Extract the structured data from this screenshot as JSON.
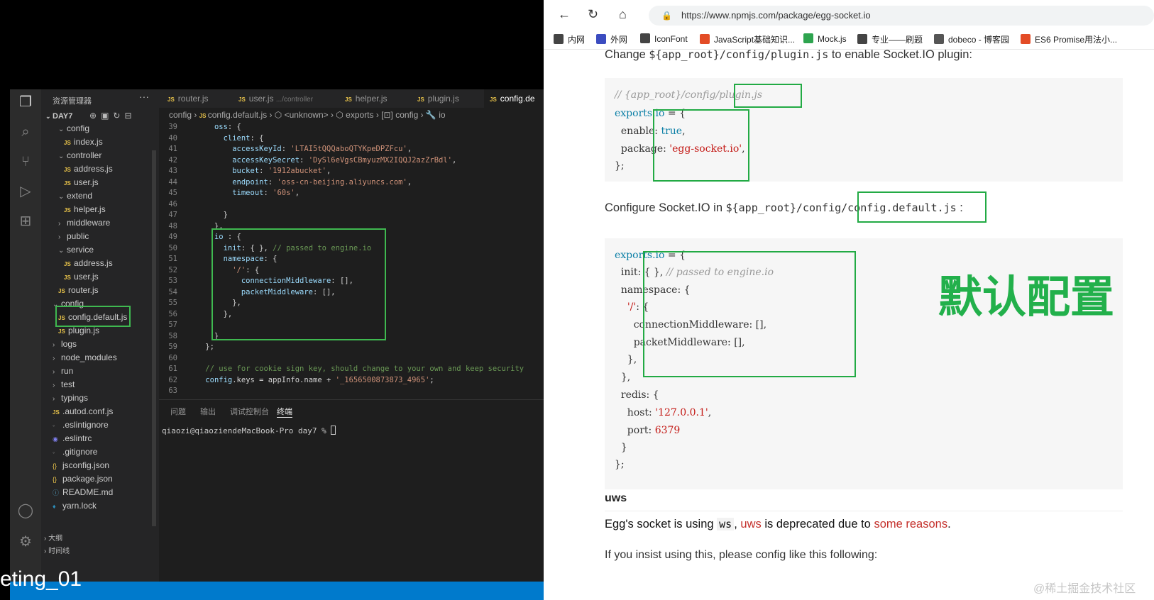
{
  "vscode": {
    "explorer_title": "资源管理器",
    "explorer_more": "···",
    "project": "DAY7",
    "tree": [
      {
        "label": "config",
        "type": "folder",
        "open": true,
        "depth": 1
      },
      {
        "label": "index.js",
        "type": "js",
        "depth": 2
      },
      {
        "label": "controller",
        "type": "folder",
        "open": true,
        "depth": 1
      },
      {
        "label": "address.js",
        "type": "js",
        "depth": 2
      },
      {
        "label": "user.js",
        "type": "js",
        "depth": 2
      },
      {
        "label": "extend",
        "type": "folder",
        "open": true,
        "depth": 1
      },
      {
        "label": "helper.js",
        "type": "js",
        "depth": 2
      },
      {
        "label": "middleware",
        "type": "folder",
        "open": false,
        "depth": 1
      },
      {
        "label": "public",
        "type": "folder",
        "open": false,
        "depth": 1
      },
      {
        "label": "service",
        "type": "folder",
        "open": true,
        "depth": 1
      },
      {
        "label": "address.js",
        "type": "js",
        "depth": 2
      },
      {
        "label": "user.js",
        "type": "js",
        "depth": 2
      },
      {
        "label": "router.js",
        "type": "js",
        "depth": 1
      },
      {
        "label": "config",
        "type": "folder",
        "open": true,
        "depth": 0
      },
      {
        "label": "config.default.js",
        "type": "js",
        "depth": 1,
        "selected": true
      },
      {
        "label": "plugin.js",
        "type": "js",
        "depth": 1
      },
      {
        "label": "logs",
        "type": "folder",
        "open": false,
        "depth": 0
      },
      {
        "label": "node_modules",
        "type": "folder",
        "open": false,
        "depth": 0
      },
      {
        "label": "run",
        "type": "folder",
        "open": false,
        "depth": 0
      },
      {
        "label": "test",
        "type": "folder",
        "open": false,
        "depth": 0
      },
      {
        "label": "typings",
        "type": "folder",
        "open": false,
        "depth": 0
      },
      {
        "label": ".autod.conf.js",
        "type": "js",
        "depth": 0
      },
      {
        "label": ".eslintignore",
        "type": "dot",
        "depth": 0
      },
      {
        "label": ".eslintrc",
        "type": "eslint",
        "depth": 0
      },
      {
        "label": ".gitignore",
        "type": "dot",
        "depth": 0
      },
      {
        "label": "jsconfig.json",
        "type": "json",
        "depth": 0
      },
      {
        "label": "package.json",
        "type": "json",
        "depth": 0
      },
      {
        "label": "README.md",
        "type": "info",
        "depth": 0
      },
      {
        "label": "yarn.lock",
        "type": "yarn",
        "depth": 0
      }
    ],
    "outline_label": "大纲",
    "timeline_label": "时间线",
    "tabs": [
      {
        "label": "router.js",
        "sub": ""
      },
      {
        "label": "user.js",
        "sub": ".../controller"
      },
      {
        "label": "helper.js",
        "sub": ""
      },
      {
        "label": "plugin.js",
        "sub": ""
      },
      {
        "label": "config.de",
        "sub": "",
        "active": true
      }
    ],
    "breadcrumb": [
      "config",
      "config.default.js",
      "<unknown>",
      "exports",
      "config",
      "io"
    ],
    "code_lines": [
      {
        "n": "39",
        "t": "      oss: {"
      },
      {
        "n": "40",
        "t": "        client: {"
      },
      {
        "n": "41",
        "t": "          accessKeyId: 'LTAI5tQQQaboQTYKpeDPZFcu',"
      },
      {
        "n": "42",
        "t": "          accessKeySecret: 'DySl6eVgsCBmyuzMX2IQQJ2azZrBdl',"
      },
      {
        "n": "43",
        "t": "          bucket: '1912abucket',"
      },
      {
        "n": "44",
        "t": "          endpoint: 'oss-cn-beijing.aliyuncs.com',"
      },
      {
        "n": "45",
        "t": "          timeout: '60s',"
      },
      {
        "n": "46",
        "t": ""
      },
      {
        "n": "47",
        "t": "        }"
      },
      {
        "n": "48",
        "t": "      },"
      },
      {
        "n": "49",
        "t": "      io : {"
      },
      {
        "n": "50",
        "t": "        init: { }, // passed to engine.io"
      },
      {
        "n": "51",
        "t": "        namespace: {"
      },
      {
        "n": "52",
        "t": "          '/': {"
      },
      {
        "n": "53",
        "t": "            connectionMiddleware: [],"
      },
      {
        "n": "54",
        "t": "            packetMiddleware: [],"
      },
      {
        "n": "55",
        "t": "          },"
      },
      {
        "n": "56",
        "t": "        },"
      },
      {
        "n": "57",
        "t": ""
      },
      {
        "n": "58",
        "t": "      }"
      },
      {
        "n": "59",
        "t": "    };"
      },
      {
        "n": "60",
        "t": ""
      },
      {
        "n": "61",
        "t": "    // use for cookie sign key, should change to your own and keep security"
      },
      {
        "n": "62",
        "t": "    config.keys = appInfo.name + '_1656500873873_4965';"
      },
      {
        "n": "63",
        "t": ""
      }
    ],
    "panel_tabs": [
      "问题",
      "输出",
      "调试控制台",
      "终端"
    ],
    "terminal_line": "qiaozi@qiaoziendeMacBook-Pro day7 % ",
    "overlay_text": "eting_01"
  },
  "browser": {
    "url": "https://www.npmjs.com/package/egg-socket.io",
    "bookmarks": [
      {
        "label": "内网",
        "color": "#444"
      },
      {
        "label": "外网",
        "color": "#3b4cc0"
      },
      {
        "label": "IconFont",
        "color": "#444"
      },
      {
        "label": "JavaScript基础知识...",
        "color": "#e34c26"
      },
      {
        "label": "Mock.js",
        "color": "#2ea44f"
      },
      {
        "label": "专业——刷题",
        "color": "#444"
      },
      {
        "label": "dobeco - 博客园",
        "color": "#555"
      },
      {
        "label": "ES6 Promise用法小...",
        "color": "#e34c26"
      }
    ],
    "line1_prefix": "Change ",
    "line1_code": "${app_root}/config/plugin.js",
    "line1_suffix": " to enable Socket.IO plugin:",
    "block1": [
      "// {app_root}/config/plugin.js",
      "exports.io = {",
      "  enable: true,",
      "  package: 'egg-socket.io',",
      "};"
    ],
    "line2_prefix": "Configure Socket.IO in ",
    "line2_code": "${app_root}/config/config.default.js",
    "line2_suffix": " :",
    "block2": [
      "exports.io = {",
      "  init: { }, // passed to engine.io",
      "  namespace: {",
      "    '/': {",
      "      connectionMiddleware: [],",
      "      packetMiddleware: [],",
      "    },",
      "  },",
      "  redis: {",
      "    host: '127.0.0.1',",
      "    port: 6379",
      "  }",
      "};"
    ],
    "annotation": "默认配置",
    "uws_heading": "uws",
    "uws_text_1": "Egg's socket is using ",
    "uws_code": "ws",
    "uws_text_2": ", ",
    "uws_link1": "uws",
    "uws_text_3": " is deprecated due to ",
    "uws_link2": "some reasons",
    "uws_text_4": ".",
    "insist_text": "If you insist using this, please config like this following:",
    "watermark": "@稀土掘金技术社区"
  }
}
